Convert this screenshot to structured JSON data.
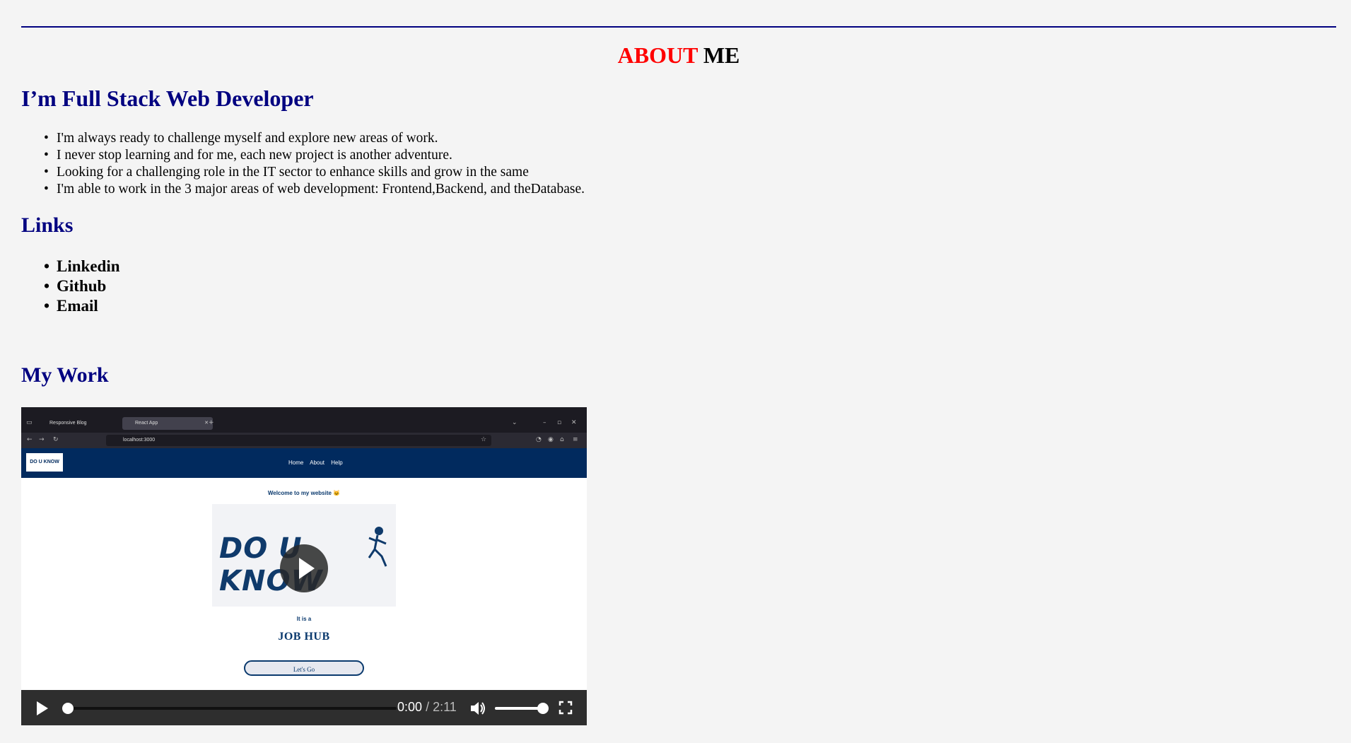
{
  "header": {
    "title_red": "ABOUT",
    "title_black": "ME"
  },
  "intro": {
    "heading": "I’m Full Stack Web Developer",
    "bullets": [
      "I'm always ready to challenge myself and explore new areas of work.",
      "I never stop learning and for me, each new project is another adventure.",
      "Looking for a challenging role in the IT sector to enhance skills and grow in the same",
      "I'm able to work in the 3 major areas of web development: Frontend,Backend, and theDatabase."
    ]
  },
  "links": {
    "heading": "Links",
    "items": [
      "Linkedin",
      "Github",
      "Email"
    ]
  },
  "work": {
    "heading": "My Work",
    "video": {
      "browser_tabs": [
        "Responsive Blog",
        "React App"
      ],
      "url": "localhost:3000",
      "app_logo": "DO U KNOW",
      "app_menu": [
        "Home",
        "About",
        "Help"
      ],
      "welcome": "Welcome to my website 🐱",
      "hero_text": "DO U KNOW",
      "it_is_a": "It is a",
      "job_hub": "JOB HUB",
      "cta": "Let's Go",
      "current_time": "0:00",
      "duration": "/ 2:11",
      "progress": 0,
      "volume": 0.85
    }
  }
}
